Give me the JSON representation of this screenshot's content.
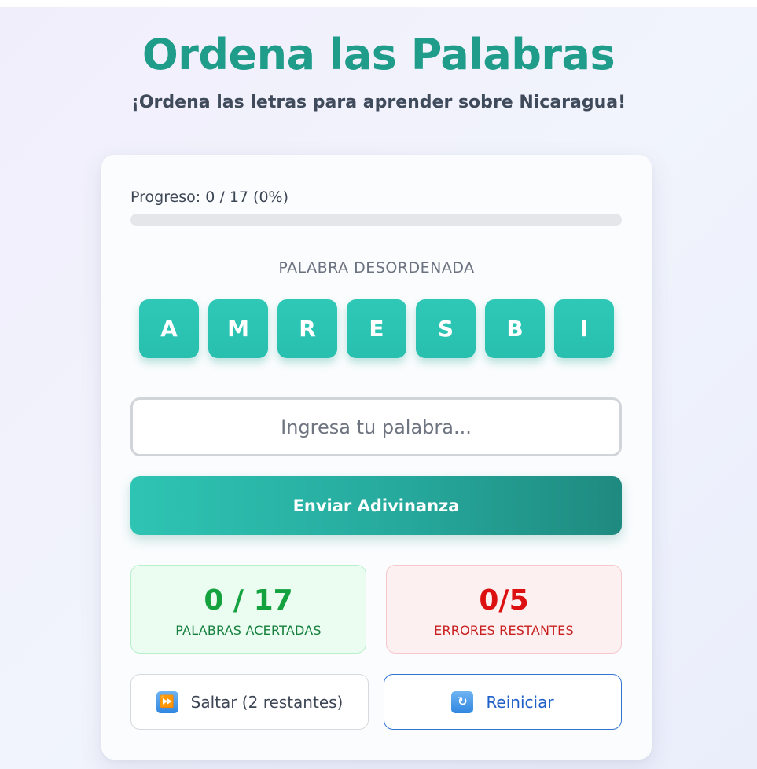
{
  "header": {
    "title": "Ordena las Palabras",
    "subtitle": "¡Ordena las letras para aprender sobre Nicaragua!"
  },
  "progress": {
    "label": "Progreso: 0 / 17 (0%)",
    "fraction": 0
  },
  "scrambled": {
    "label": "PALABRA DESORDENADA",
    "letters": [
      "A",
      "M",
      "R",
      "E",
      "S",
      "B",
      "I"
    ]
  },
  "guess": {
    "placeholder": "Ingresa tu palabra...",
    "value": ""
  },
  "submit_label": "Enviar Adivinanza",
  "stats": {
    "correct": {
      "value": "0 / 17",
      "label": "PALABRAS ACERTADAS"
    },
    "errors": {
      "value": "0/5",
      "label": "ERRORES RESTANTES"
    }
  },
  "actions": {
    "skip": {
      "label": "Saltar (2 restantes)",
      "icon": "fast-forward-icon"
    },
    "reset": {
      "label": "Reiniciar",
      "icon": "refresh-icon"
    }
  },
  "colors": {
    "accent": "#2ec4b6",
    "title": "#1f9c8a",
    "success": "#14a23e",
    "danger": "#dc1010",
    "link": "#1e5fc8"
  }
}
